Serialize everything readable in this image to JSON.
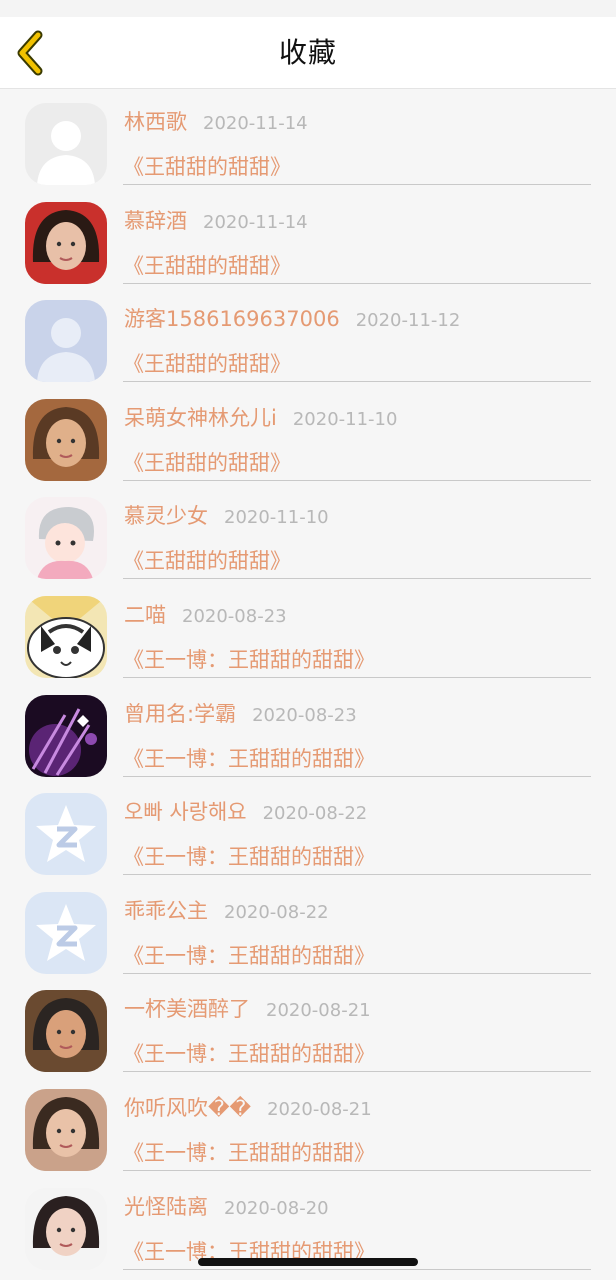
{
  "nav": {
    "title": "收藏",
    "back_icon": "chevron-left-icon",
    "accent_color": "#f2c200"
  },
  "theme": {
    "name_color": "#e59a73",
    "date_color": "#b8b8b8",
    "background": "#f6f6f6"
  },
  "favorites": [
    {
      "name": "林西歌",
      "date": "2020-11-14",
      "title": "《王甜甜的甜甜》",
      "avatar": "default-user-silhouette-icon"
    },
    {
      "name": "慕辞酒",
      "date": "2020-11-14",
      "title": "《王甜甜的甜甜》",
      "avatar": "user-photo-avatar"
    },
    {
      "name": "游客1586169637006",
      "date": "2020-11-12",
      "title": "《王甜甜的甜甜》",
      "avatar": "guest-silhouette-icon"
    },
    {
      "name": "呆萌女神林允儿i",
      "date": "2020-11-10",
      "title": "《王甜甜的甜甜》",
      "avatar": "user-photo-avatar"
    },
    {
      "name": "慕灵少女",
      "date": "2020-11-10",
      "title": "《王甜甜的甜甜》",
      "avatar": "anime-character-avatar"
    },
    {
      "name": "二喵",
      "date": "2020-08-23",
      "title": "《王一博：王甜甜的甜甜》",
      "avatar": "cartoon-cat-avatar"
    },
    {
      "name": "曾用名:学霸",
      "date": "2020-08-23",
      "title": "《王一博：王甜甜的甜甜》",
      "avatar": "purple-art-avatar"
    },
    {
      "name": "오빠 사랑해요",
      "date": "2020-08-22",
      "title": "《王一博：王甜甜的甜甜》",
      "avatar": "qzone-star-icon"
    },
    {
      "name": "乖乖公主",
      "date": "2020-08-22",
      "title": "《王一博：王甜甜的甜甜》",
      "avatar": "qzone-star-icon"
    },
    {
      "name": "一杯美酒醉了",
      "date": "2020-08-21",
      "title": "《王一博：王甜甜的甜甜》",
      "avatar": "user-photo-avatar"
    },
    {
      "name": "你听风吹��",
      "date": "2020-08-21",
      "title": "《王一博：王甜甜的甜甜》",
      "avatar": "user-photo-avatar"
    },
    {
      "name": "光怪陆离",
      "date": "2020-08-20",
      "title": "《王一博：王甜甜的甜甜》",
      "avatar": "user-photo-avatar"
    }
  ]
}
